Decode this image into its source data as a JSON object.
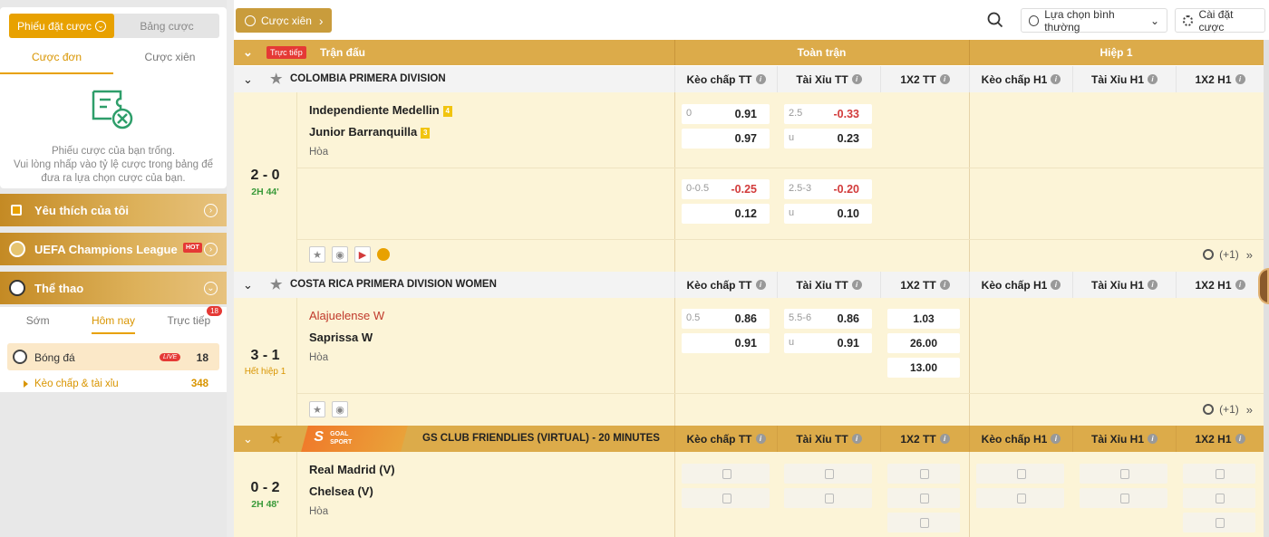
{
  "betslip": {
    "tab_active": "Phiếu đặt cược",
    "tab_other": "Bảng cược",
    "sub_tab_single": "Cược đơn",
    "sub_tab_combo": "Cược xiên",
    "empty_line1": "Phiếu cược của bạn trống.",
    "empty_line2": "Vui lòng nhấp vào tỷ lệ cược trong bảng để",
    "empty_line3": "đưa ra lựa chọn cược của bạn."
  },
  "sidebar": {
    "favorites": "Yêu thích của tôi",
    "ucl": "UEFA Champions League",
    "hot_badge": "HOT",
    "sports": "Thể thao",
    "tabs": [
      "Sớm",
      "Hôm nay",
      "Trực tiếp"
    ],
    "live_count_badge": "18",
    "football_label": "Bóng đá",
    "football_live": "LIVE",
    "football_count": "18",
    "sub_item_label": "Kèo chấp & tài xỉu",
    "sub_item_count": "348"
  },
  "topbar": {
    "combo_button": "Cược xiên",
    "mode_select": "Lựa chọn bình thường",
    "settings": "Cài đặt cược"
  },
  "table": {
    "live_tag": "Trực tiếp",
    "match_col": "Trận đấu",
    "full_match": "Toàn trận",
    "half1": "Hiệp 1",
    "cols": [
      "Kèo chấp TT",
      "Tài Xỉu TT",
      "1X2 TT",
      "Kèo chấp H1",
      "Tài Xỉu H1",
      "1X2 H1"
    ],
    "more": "(+1)",
    "leagues": [
      {
        "name": "COLOMBIA PRIMERA DIVISION",
        "match": {
          "score": "2 - 0",
          "time": "2H 44'",
          "home": "Independiente Medellin",
          "home_card": "4",
          "away": "Junior Barranquilla",
          "away_card": "3",
          "draw": "Hòa",
          "lines": [
            {
              "hdp": "0",
              "hdp_home": "0.91",
              "hdp_away": "0.97",
              "ou": "2.5",
              "ou_over": "-0.33",
              "ou_u": "u",
              "ou_under": "0.23"
            },
            {
              "hdp": "0-0.5",
              "hdp_home": "-0.25",
              "hdp_away": "0.12",
              "ou": "2.5-3",
              "ou_over": "-0.20",
              "ou_u": "u",
              "ou_under": "0.10"
            }
          ]
        }
      },
      {
        "name": "COSTA RICA PRIMERA DIVISION WOMEN",
        "match": {
          "score": "3 - 1",
          "time": "Hết hiệp 1",
          "home": "Alajuelense W",
          "away": "Saprissa W",
          "draw": "Hòa",
          "hdp": "0.5",
          "hdp_home": "0.86",
          "hdp_away": "0.91",
          "ou": "5.5-6",
          "ou_over": "0.86",
          "ou_u": "u",
          "ou_under": "0.91",
          "x1": "1.03",
          "x2": "26.00",
          "xd": "13.00"
        }
      },
      {
        "name": "GS CLUB FRIENDLIES (VIRTUAL) - 20 MINUTES",
        "logo_text": "GOAL SPORT",
        "match": {
          "score": "0 - 2",
          "time": "2H 48'",
          "home": "Real Madrid (V)",
          "away": "Chelsea (V)",
          "draw": "Hòa"
        }
      }
    ]
  },
  "colors": {
    "accent": "#e8a100",
    "header_gold": "#dcab4a",
    "match_bg": "#fcf4d7",
    "negative": "#d23b3b",
    "live_time": "#3a9a3a"
  }
}
